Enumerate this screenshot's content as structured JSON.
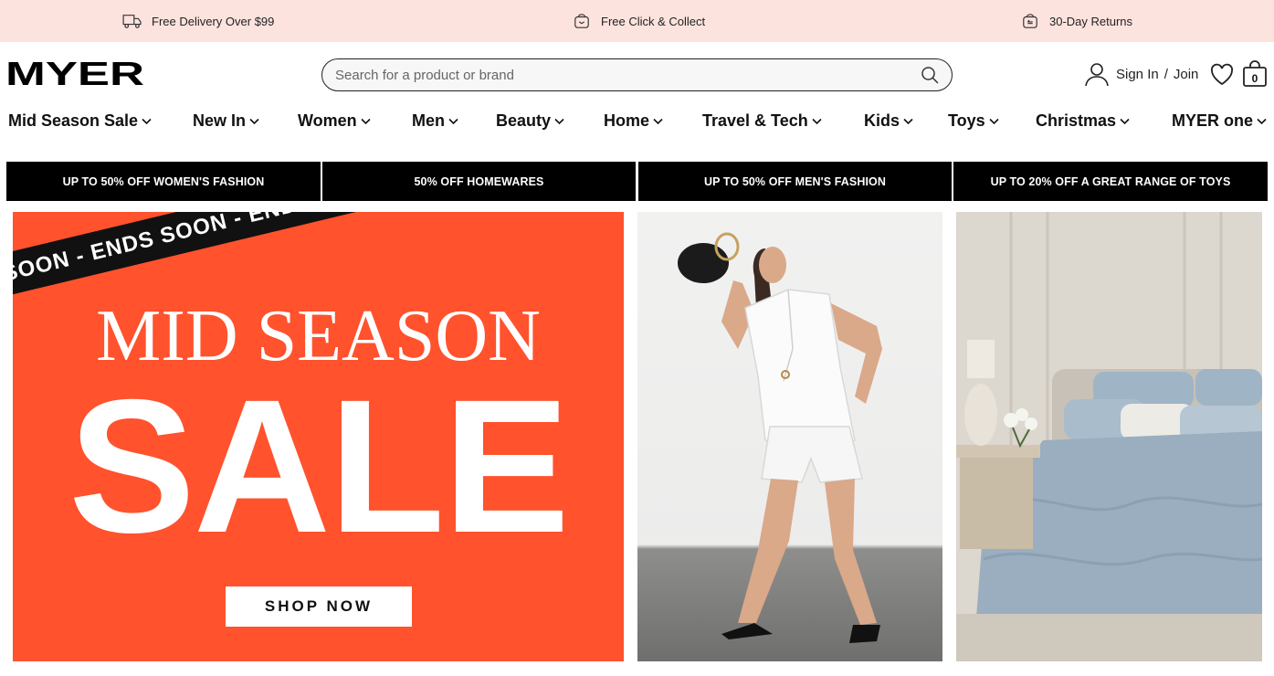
{
  "promo_strip": {
    "items": [
      {
        "label": "Free Delivery Over $99",
        "icon": "truck-icon"
      },
      {
        "label": "Free Click & Collect",
        "icon": "bag-click-icon"
      },
      {
        "label": "30-Day Returns",
        "icon": "returns-icon"
      }
    ]
  },
  "header": {
    "logo_text": "MYER",
    "search": {
      "placeholder": "Search for a product or brand",
      "value": ""
    },
    "account": {
      "sign_in": "Sign In",
      "separator": "/",
      "join": "Join"
    },
    "bag_count": "0"
  },
  "nav": {
    "items": [
      {
        "label": "Mid Season Sale"
      },
      {
        "label": "New In"
      },
      {
        "label": "Women"
      },
      {
        "label": "Men"
      },
      {
        "label": "Beauty"
      },
      {
        "label": "Home"
      },
      {
        "label": "Travel & Tech"
      },
      {
        "label": "Kids"
      },
      {
        "label": "Toys"
      },
      {
        "label": "Christmas"
      },
      {
        "label": "MYER one"
      }
    ]
  },
  "offers": [
    {
      "label": "UP TO 50% OFF WOMEN'S FASHION"
    },
    {
      "label": "50% OFF HOMEWARES"
    },
    {
      "label": "UP TO 50% OFF MEN'S FASHION"
    },
    {
      "label": "UP TO 20% OFF A GREAT RANGE OF TOYS"
    }
  ],
  "hero": {
    "ribbon_text": "DS SOON - ENDS SOON - ENDS SOON - ENDS SOON",
    "title": "MID SEASON",
    "sale_text": "SALE",
    "cta": "SHOP NOW",
    "background_color": "#ff522d"
  },
  "colors": {
    "promo_bg": "#fde3de",
    "offer_bar_bg": "#000000",
    "accent": "#ff522d"
  }
}
